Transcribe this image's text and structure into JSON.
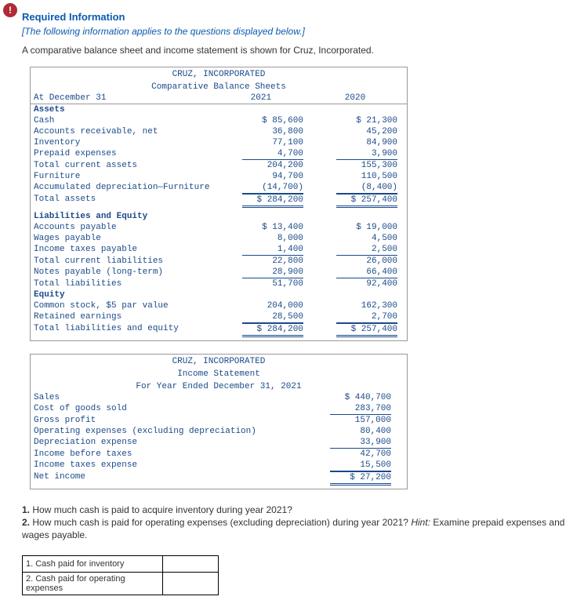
{
  "header": {
    "alert_glyph": "!",
    "required_title": "Required Information",
    "subtitle": "[The following information applies to the questions displayed below.]",
    "intro": "A comparative balance sheet and income statement is shown for Cruz, Incorporated."
  },
  "balance_sheet": {
    "title1": "CRUZ, INCORPORATED",
    "title2": "Comparative Balance Sheets",
    "col_date_label": "At December 31",
    "col1": "2021",
    "col2": "2020",
    "assets_hdr": "Assets",
    "rows": {
      "cash": {
        "label": "Cash",
        "y1": "$ 85,600",
        "y2": "$ 21,300"
      },
      "ar": {
        "label": "Accounts receivable, net",
        "y1": "36,800",
        "y2": "45,200"
      },
      "inv": {
        "label": "Inventory",
        "y1": "77,100",
        "y2": "84,900"
      },
      "prepaid": {
        "label": "Prepaid expenses",
        "y1": "4,700",
        "y2": "3,900"
      },
      "tca": {
        "label": "Total current assets",
        "y1": "204,200",
        "y2": "155,300"
      },
      "furn": {
        "label": "Furniture",
        "y1": "94,700",
        "y2": "110,500"
      },
      "accdep": {
        "label": "Accumulated depreciation—Furniture",
        "y1": "(14,700)",
        "y2": "(8,400)"
      },
      "ta": {
        "label": "Total assets",
        "y1": "$ 284,200",
        "y2": "$ 257,400"
      }
    },
    "liab_hdr": "Liabilities and Equity",
    "lrows": {
      "ap": {
        "label": "Accounts payable",
        "y1": "$ 13,400",
        "y2": "$ 19,000"
      },
      "wp": {
        "label": "Wages payable",
        "y1": "8,000",
        "y2": "4,500"
      },
      "itp": {
        "label": "Income taxes payable",
        "y1": "1,400",
        "y2": "2,500"
      },
      "tcl": {
        "label": "Total current liabilities",
        "y1": "22,800",
        "y2": "26,000"
      },
      "np": {
        "label": "Notes payable (long-term)",
        "y1": "28,900",
        "y2": "66,400"
      },
      "tl": {
        "label": "Total liabilities",
        "y1": "51,700",
        "y2": "92,400"
      }
    },
    "equity_hdr": "Equity",
    "erows": {
      "cs": {
        "label": "Common stock, $5 par value",
        "y1": "204,000",
        "y2": "162,300"
      },
      "re": {
        "label": "Retained earnings",
        "y1": "28,500",
        "y2": "2,700"
      },
      "tle": {
        "label": "Total liabilities and equity",
        "y1": "$ 284,200",
        "y2": "$ 257,400"
      }
    }
  },
  "income_statement": {
    "title1": "CRUZ, INCORPORATED",
    "title2": "Income Statement",
    "title3": "For Year Ended December 31, 2021",
    "rows": {
      "sales": {
        "label": "Sales",
        "v": "$ 440,700"
      },
      "cogs": {
        "label": "Cost of goods sold",
        "v": "283,700"
      },
      "gp": {
        "label": "Gross profit",
        "v": "157,000"
      },
      "opex": {
        "label": "Operating expenses (excluding depreciation)",
        "v": "80,400"
      },
      "dep": {
        "label": "Depreciation expense",
        "v": "33,900"
      },
      "ibt": {
        "label": "Income before taxes",
        "v": "42,700"
      },
      "tax": {
        "label": "Income taxes expense",
        "v": "15,500"
      },
      "ni": {
        "label": "Net income",
        "v": "$ 27,200"
      }
    }
  },
  "questions": {
    "q1_num": "1.",
    "q1_text": "How much cash is paid to acquire inventory during year 2021?",
    "q2_num": "2.",
    "q2_text": "How much cash is paid for operating expenses (excluding depreciation) during year 2021? ",
    "q2_hint_label": "Hint:",
    "q2_hint_text": " Examine prepaid expenses and wages payable."
  },
  "answer_table": {
    "r1": "1. Cash paid for inventory",
    "r2": "2. Cash paid for operating expenses"
  }
}
